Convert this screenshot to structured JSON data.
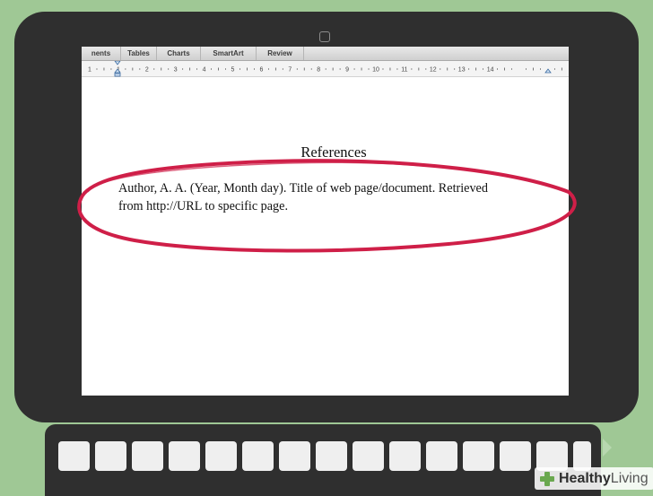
{
  "ribbon": {
    "tabs": [
      {
        "id": "elements",
        "label": "nents"
      },
      {
        "id": "tables",
        "label": "Tables"
      },
      {
        "id": "charts",
        "label": "Charts"
      },
      {
        "id": "smartart",
        "label": "SmartArt"
      },
      {
        "id": "review",
        "label": "Review"
      }
    ]
  },
  "ruler": {
    "numbers": [
      "1",
      "1",
      "2",
      "3",
      "4",
      "5",
      "6",
      "7",
      "8",
      "9",
      "10",
      "11",
      "12",
      "13",
      "14"
    ]
  },
  "document": {
    "heading": "References",
    "citation_line_1": "Author, A. A. (Year, Month day). Title of web page/document. Retrieved",
    "citation_line_2": "from http://URL to specific page."
  },
  "annotation": {
    "color": "#cf1f48"
  },
  "watermark": {
    "brand_bold": "Healthy",
    "brand_light": "Living"
  },
  "colors": {
    "background": "#9fc895",
    "device": "#2f2f2f",
    "keys": "#efefef"
  }
}
